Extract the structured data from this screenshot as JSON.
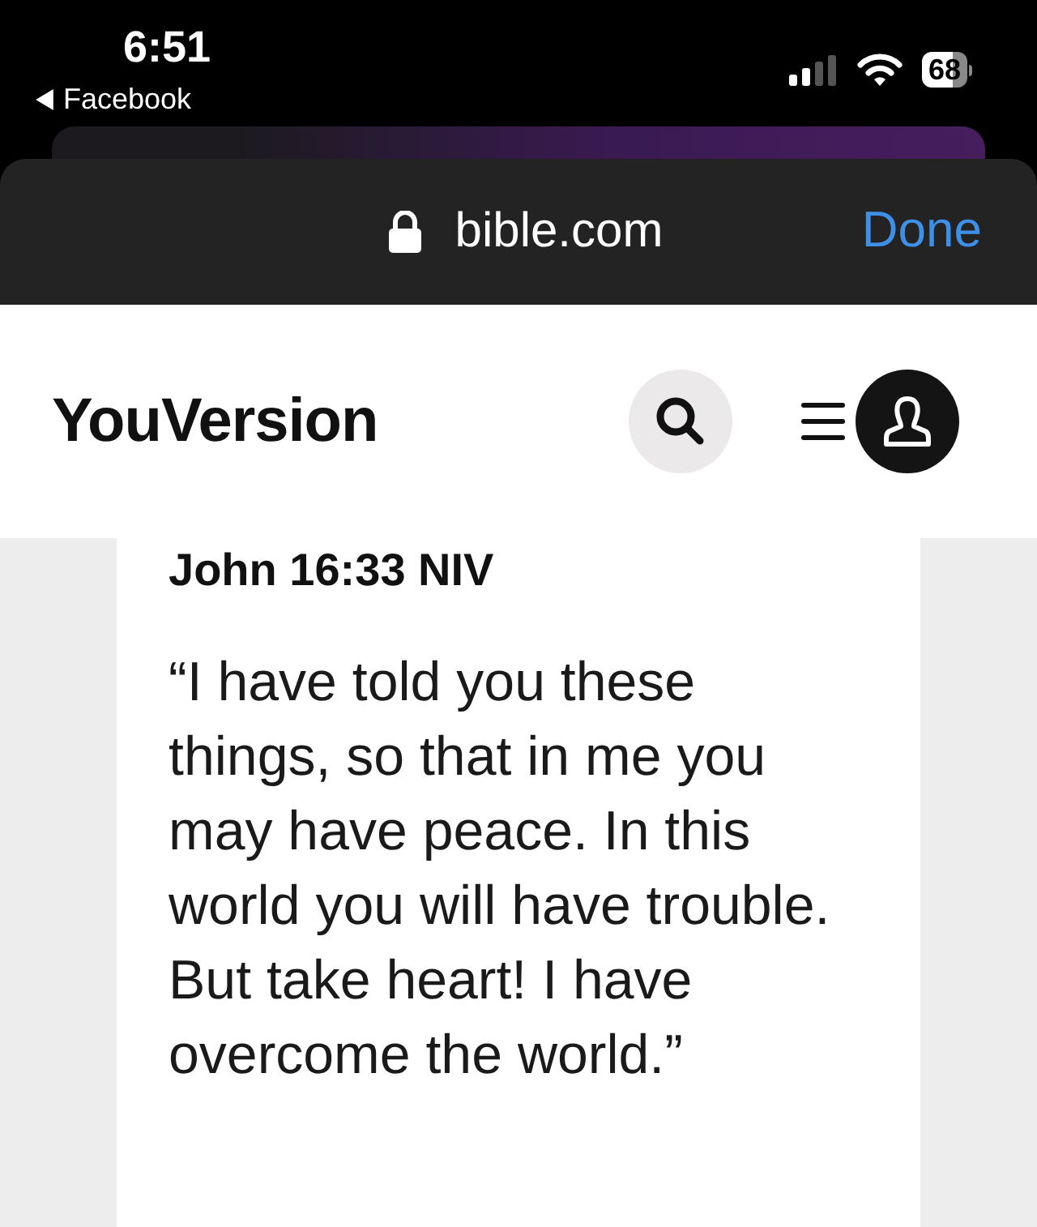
{
  "status_bar": {
    "time": "6:51",
    "back_app": "Facebook",
    "battery": "68"
  },
  "browser_bar": {
    "address": "bible.com",
    "done": "Done"
  },
  "header": {
    "logo": "YouVersion"
  },
  "verse": {
    "reference": "John 16:33 NIV",
    "text": "“I have told you these things, so that in me you may have peace. In this world you will have trouble. But take heart! I have overcome the world.”"
  }
}
